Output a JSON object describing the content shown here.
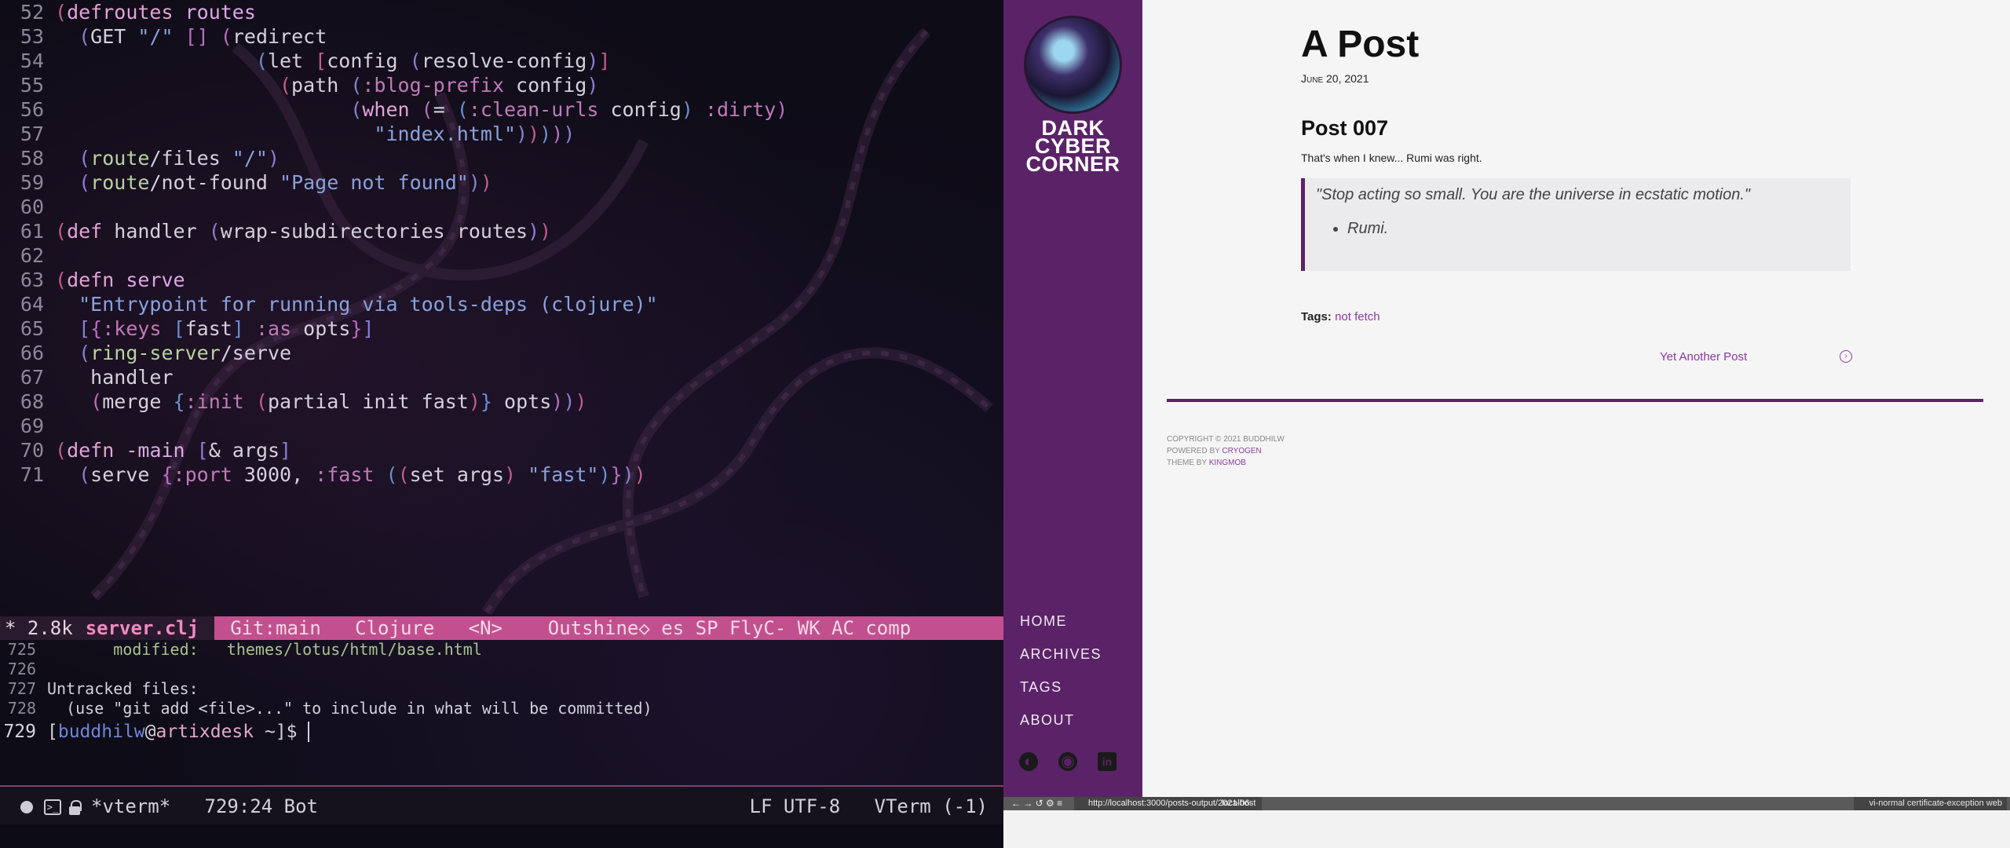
{
  "editor": {
    "lines": [
      {
        "n": "52"
      },
      {
        "n": "53"
      },
      {
        "n": "54"
      },
      {
        "n": "55"
      },
      {
        "n": "56"
      },
      {
        "n": "57"
      },
      {
        "n": "58"
      },
      {
        "n": "59"
      },
      {
        "n": "60"
      },
      {
        "n": "61"
      },
      {
        "n": "62"
      },
      {
        "n": "63"
      },
      {
        "n": "64"
      },
      {
        "n": "65"
      },
      {
        "n": "66"
      },
      {
        "n": "67"
      },
      {
        "n": "68"
      },
      {
        "n": "69"
      },
      {
        "n": "70"
      },
      {
        "n": "71"
      }
    ]
  },
  "modeline": {
    "size": "* 2.8k",
    "filename": "server.clj",
    "rest": "Git:main   Clojure   <N>    Outshine◇ es SP FlyC- WK AC comp"
  },
  "terminal": {
    "lines": [
      {
        "n": "725",
        "text": "       modified:   themes/lotus/html/base.html"
      },
      {
        "n": "726",
        "text": ""
      },
      {
        "n": "727",
        "text": "Untracked files:"
      },
      {
        "n": "728",
        "text": "  (use \"git add <file>...\" to include in what will be committed)"
      }
    ],
    "prompt_n": "729",
    "prompt_user": "buddhilw",
    "prompt_host": "artixdesk",
    "prompt_tail": " ~]$ "
  },
  "bottombar": {
    "buffer": "*vterm*",
    "position": "729:24 Bot",
    "encoding": "LF UTF-8",
    "mode": "VTerm (-1)"
  },
  "site": {
    "title_lines": [
      "DARK",
      "CYBER",
      "CORNER"
    ],
    "nav": [
      "HOME",
      "ARCHIVES",
      "TAGS",
      "ABOUT"
    ],
    "social": {
      "icon1": "◐",
      "icon2": "◉",
      "icon3": "in"
    }
  },
  "post": {
    "title": "A Post",
    "date": "June 20, 2021",
    "subtitle": "Post 007",
    "intro": "That's when I knew... Rumi was right.",
    "quote": "\"Stop acting so small. You are the universe in ecstatic motion.\"",
    "quote_author": "Rumi.",
    "tags_label": "Tags:",
    "tag": "not fetch",
    "next_link": "Yet Another Post",
    "next_icon": "›"
  },
  "footer": {
    "copyright": "COPYRIGHT © 2021 BUDDHILW",
    "powered_label": "POWERED BY ",
    "powered_link": "CRYOGEN",
    "theme_label": "THEME BY ",
    "theme_link": "KINGMOB"
  },
  "statusbar": {
    "controls": "← → ↺ ⚙ ≡",
    "url": "http://localhost:3000/posts-output/2021-06-",
    "host": "localhost",
    "flags": "vi-normal certificate-exception web"
  }
}
